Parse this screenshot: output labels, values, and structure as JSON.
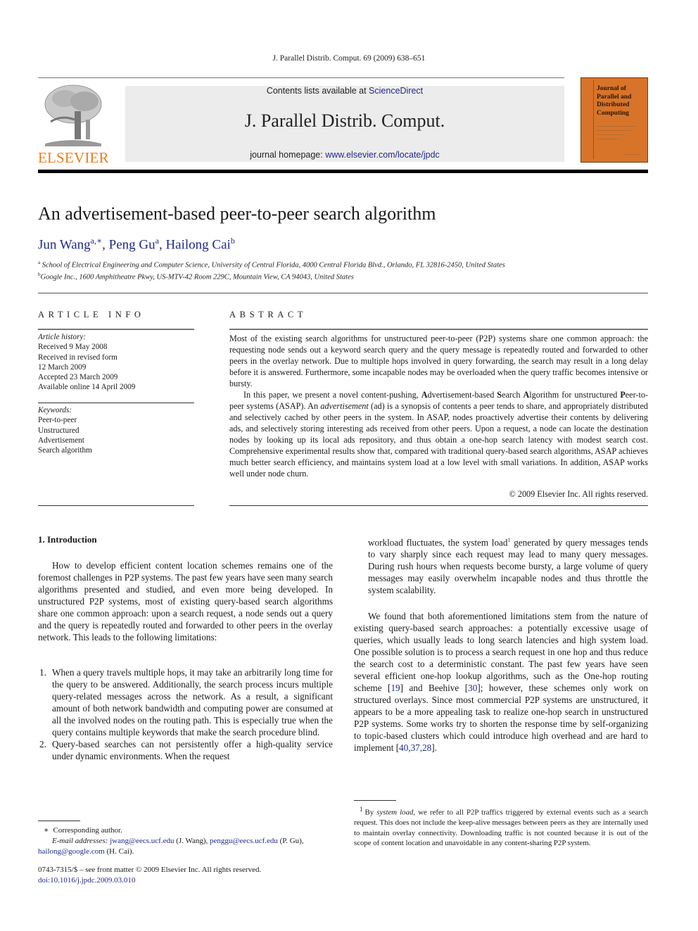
{
  "header": {
    "running_head": "J. Parallel Distrib. Comput. 69 (2009) 638–651",
    "contents_prefix": "Contents lists available at ",
    "contents_link": "ScienceDirect",
    "journal_title": "J. Parallel Distrib. Comput.",
    "homepage_prefix": "journal homepage: ",
    "homepage_link": "www.elsevier.com/locate/jpdc",
    "publisher_logo_text": "ELSEVIER",
    "cover_title": "Journal of Parallel and Distributed Computing",
    "colors": {
      "elsevier_orange": "#f07d1a",
      "cover_orange": "#d8742a",
      "link_blue": "#1f2a8a"
    }
  },
  "article": {
    "title": "An advertisement-based peer-to-peer search algorithm",
    "authors": [
      {
        "name": "Jun Wang",
        "marks": "a,∗"
      },
      {
        "name": "Peng Gu",
        "marks": "a"
      },
      {
        "name": "Hailong Cai",
        "marks": "b"
      }
    ],
    "affiliations": [
      {
        "mark": "a",
        "text": "School of Electrical Engineering and Computer Science, University of Central Florida, 4000 Central Florida Blvd., Orlando, FL 32816-2450, United States"
      },
      {
        "mark": "b",
        "text": "Google Inc., 1600 Amphitheatre Pkwy, US-MTV-42 Room 229C, Mountain View, CA 94043, United States"
      }
    ]
  },
  "article_info": {
    "heading": "ARTICLE INFO",
    "history_label": "Article history:",
    "history": [
      "Received 9 May 2008",
      "Received in revised form",
      "12 March 2009",
      "Accepted 23 March 2009",
      "Available online 14 April 2009"
    ],
    "keywords_label": "Keywords:",
    "keywords": [
      "Peer-to-peer",
      "Unstructured",
      "Advertisement",
      "Search algorithm"
    ]
  },
  "abstract": {
    "heading": "ABSTRACT",
    "para1": "Most of the existing search algorithms for unstructured peer-to-peer (P2P) systems share one common approach: the requesting node sends out a keyword search query and the query message is repeatedly routed and forwarded to other peers in the overlay network. Due to multiple hops involved in query forwarding, the search may result in a long delay before it is answered. Furthermore, some incapable nodes may be overloaded when the query traffic becomes intensive or bursty.",
    "para2": {
      "p1": "In this paper, we present a novel content-pushing, ",
      "b1": "A",
      "p2": "dvertisement-based ",
      "b2": "S",
      "p3": "earch ",
      "b3": "A",
      "p4": "lgorithm for unstructured ",
      "b4": "P",
      "p5": "eer-to-peer systems (ASAP). An ",
      "i1": "advertisement",
      "p6": " (ad) is a synopsis of contents a peer tends to share, and appropriately distributed and selectively cached by other peers in the system. In ASAP, nodes proactively advertise their contents by delivering ads, and selectively storing interesting ads received from other peers. Upon a request, a node can locate the destination nodes by looking up its local ads repository, and thus obtain a one-hop search latency with modest search cost. Comprehensive experimental results show that, compared with traditional query-based search algorithms, ASAP achieves much better search efficiency, and maintains system load at a low level with small variations. In addition, ASAP works well under node churn."
    },
    "copyright": "© 2009 Elsevier Inc. All rights reserved."
  },
  "body": {
    "section_heading": "1.  Introduction",
    "intro_para": "How to develop efficient content location schemes remains one of the foremost challenges in P2P systems. The past few years have seen many search algorithms presented and studied, and even more being developed. In unstructured P2P systems, most of existing query-based search algorithms share one common approach: upon a search request, a node sends out a query and the query is repeatedly routed and forwarded to other peers in the overlay network. This leads to the following limitations:",
    "limitations": [
      {
        "num": "1.",
        "text": "When a query travels multiple hops, it may take an arbitrarily long time for the query to be answered. Additionally, the search process incurs multiple query-related messages across the network. As a result, a significant amount of both network bandwidth and computing power are consumed at all the involved nodes on the routing path. This is especially true when the query contains multiple keywords that make the search procedure blind."
      },
      {
        "num": "2.",
        "text": "Query-based searches can not persistently offer a high-quality service under dynamic environments. When the request"
      }
    ],
    "col2_continuation": {
      "before": "workload fluctuates, the system load",
      "fn_mark": "1",
      "after": " generated by query messages tends to vary sharply since each request may lead to many query messages. During rush hours when requests become bursty, a large volume of query messages may easily overwhelm incapable nodes and thus throttle the system scalability."
    },
    "col2_para": {
      "t1": "We found that both aforementioned limitations stem from the nature of existing query-based search approaches: a potentially excessive usage of queries, which usually leads to long search latencies and high system load. One possible solution is to process a search request in one hop and thus reduce the search cost to a deterministic constant. The past few years have seen several efficient one-hop lookup algorithms, such as the One-hop routing scheme [",
      "c1": "19",
      "t2": "] and Beehive [",
      "c2": "30",
      "t3": "]; however, these schemes only work on structured overlays. Since most commercial P2P systems are unstructured, it appears to be a more appealing task to realize one-hop search in unstructured P2P systems. Some works try to shorten the response time by self-organizing to topic-based clusters which could introduce high overhead and are hard to implement [",
      "c3": "40,37,28",
      "t4": "]."
    }
  },
  "footnotes": {
    "corresponding_mark": "∗",
    "corresponding_text": "Corresponding author.",
    "email_label": "E-mail addresses:",
    "emails": [
      {
        "address": "jwang@eecs.ucf.edu",
        "who": " (J. Wang), "
      },
      {
        "address": "penggu@eecs.ucf.edu",
        "who": " (P. Gu),"
      },
      {
        "address": "hailong@google.com",
        "who": " (H. Cai)."
      }
    ],
    "front_matter": "0743-7315/$ – see front matter © 2009 Elsevier Inc. All rights reserved.",
    "doi": "doi:10.1016/j.jpdc.2009.03.010",
    "fn1_mark": "1",
    "fn1_pre": "By ",
    "fn1_italic": "system load",
    "fn1_post": ", we refer to all P2P traffics triggered by external events such as a search request. This does not include the keep-alive messages between peers as they are internally used to maintain overlay connectivity. Downloading traffic is not counted because it is out of the scope of content location and unavoidable in any content-sharing P2P system."
  }
}
